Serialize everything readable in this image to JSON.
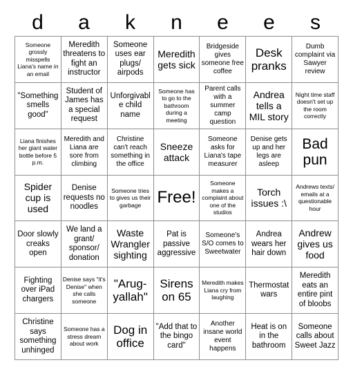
{
  "header": {
    "letters": [
      "d",
      "a",
      "k",
      "n",
      "e",
      "e",
      "s"
    ]
  },
  "grid": {
    "columns": 7,
    "rows": 7,
    "free_index": 24,
    "cells": [
      {
        "text": "Someone grossly misspells Liana's name in an email",
        "size": "t-xs"
      },
      {
        "text": "Meredith threatens to fight an instructor",
        "size": "t-m"
      },
      {
        "text": "Someone uses ear plugs/ airpods",
        "size": "t-m"
      },
      {
        "text": "Meredith gets sick",
        "size": "t-l"
      },
      {
        "text": "Bridgeside gives someone free coffee",
        "size": "t-s"
      },
      {
        "text": "Desk pranks",
        "size": "t-xl"
      },
      {
        "text": "Dumb complaint via Sawyer review",
        "size": "t-s"
      },
      {
        "text": "\"Something smells good\"",
        "size": "t-m"
      },
      {
        "text": "Student of James has a special request",
        "size": "t-m"
      },
      {
        "text": "Unforgivable child name",
        "size": "t-m"
      },
      {
        "text": "Someone has to go to the bathroom during a meeting",
        "size": "t-xs"
      },
      {
        "text": "Parent calls with a summer camp question",
        "size": "t-s"
      },
      {
        "text": "Andrea tells a MIL story",
        "size": "t-l"
      },
      {
        "text": "Night time staff doesn't set up the room correctly",
        "size": "t-xs"
      },
      {
        "text": "Liana finishes her giant water bottle before 5 p.m.",
        "size": "t-xs"
      },
      {
        "text": "Meredith and Liana are sore from climbing",
        "size": "t-s"
      },
      {
        "text": "Christine can't reach something in the office",
        "size": "t-s"
      },
      {
        "text": "Sneeze attack",
        "size": "t-l"
      },
      {
        "text": "Someone asks for Liana's tape measurer",
        "size": "t-s"
      },
      {
        "text": "Denise gets up and her legs are asleep",
        "size": "t-s"
      },
      {
        "text": "Bad pun",
        "size": "t-xxl"
      },
      {
        "text": "Spider cup is used",
        "size": "t-l"
      },
      {
        "text": "Denise requests no noodles",
        "size": "t-m"
      },
      {
        "text": "Someone tries to gives us their garbage",
        "size": "t-xs"
      },
      {
        "text": "Free!",
        "size": "t-free"
      },
      {
        "text": "Someone makes a complaint about one of the studios",
        "size": "t-xs"
      },
      {
        "text": "Torch issues :\\",
        "size": "t-l"
      },
      {
        "text": "Andrews texts/ emails at a questionable hour",
        "size": "t-xs"
      },
      {
        "text": "Door slowly creaks open",
        "size": "t-m"
      },
      {
        "text": "We land a grant/ sponsor/ donation",
        "size": "t-m"
      },
      {
        "text": "Waste Wrangler sighting",
        "size": "t-l"
      },
      {
        "text": "Pat is passive aggressive",
        "size": "t-m"
      },
      {
        "text": "Someone's S/O comes to Sweetwater",
        "size": "t-s"
      },
      {
        "text": "Andrea wears her hair down",
        "size": "t-m"
      },
      {
        "text": "Andrew gives us food",
        "size": "t-l"
      },
      {
        "text": "Fighting over iPad chargers",
        "size": "t-m"
      },
      {
        "text": "Denise says \"it's Denise\" when she calls someone",
        "size": "t-xs"
      },
      {
        "text": "\"Arug-yallah\"",
        "size": "t-xl"
      },
      {
        "text": "Sirens on 65",
        "size": "t-xl"
      },
      {
        "text": "Meredith makes Liana cry from laughing",
        "size": "t-xs"
      },
      {
        "text": "Thermostat wars",
        "size": "t-m"
      },
      {
        "text": "Meredith eats an entire pint of bloobs",
        "size": "t-m"
      },
      {
        "text": "Christine says something unhinged",
        "size": "t-m"
      },
      {
        "text": "Someone has a stress dream about work",
        "size": "t-xs"
      },
      {
        "text": "Dog in office",
        "size": "t-xl"
      },
      {
        "text": "\"Add that to the bingo card\"",
        "size": "t-m"
      },
      {
        "text": "Another insane world event happens",
        "size": "t-s"
      },
      {
        "text": "Heat is on in the bathroom",
        "size": "t-m"
      },
      {
        "text": "Someone calls about Sweet Jazz",
        "size": "t-m"
      }
    ]
  },
  "colors": {
    "background": "#ffffff",
    "text": "#000000",
    "grid_line": "#8d8d8d"
  }
}
